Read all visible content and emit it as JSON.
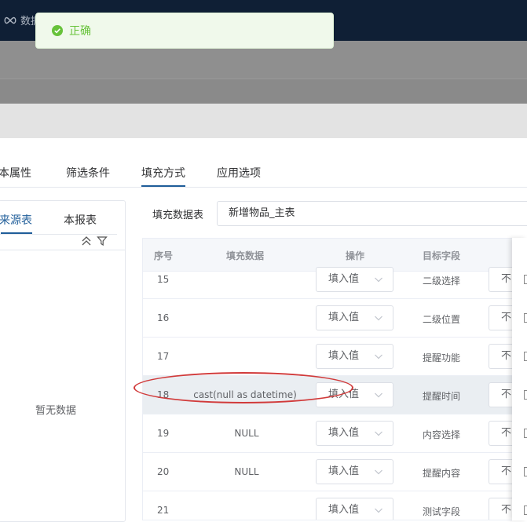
{
  "topbar": {
    "brand_icon": "infinity-icon",
    "brand_text": "数据"
  },
  "toast": {
    "text": "正确",
    "icon": "check-circle-icon",
    "color": "#67c23a"
  },
  "tabs": [
    {
      "label": "本属性"
    },
    {
      "label": "筛选条件"
    },
    {
      "label": "填充方式",
      "active": true
    },
    {
      "label": "应用选项"
    }
  ],
  "left_panel": {
    "tabs": [
      {
        "label": "来源表",
        "active": true
      },
      {
        "label": "本报表"
      }
    ],
    "empty_text": "暂无数据"
  },
  "fill_table": {
    "label": "填充数据表",
    "value": "新增物品_主表"
  },
  "table": {
    "headers": {
      "idx": "序号",
      "data": "填充数据",
      "op": "操作",
      "target": "目标字段"
    },
    "rows": [
      {
        "idx": "15",
        "data": "",
        "op": "填入值",
        "target": "二级选择",
        "extra": "不"
      },
      {
        "idx": "16",
        "data": "",
        "op": "填入值",
        "target": "二级位置",
        "extra": "不"
      },
      {
        "idx": "17",
        "data": "",
        "op": "填入值",
        "target": "提醒功能",
        "extra": "不"
      },
      {
        "idx": "18",
        "data": "cast(null as datetime)",
        "op": "填入值",
        "target": "提醒时间",
        "extra": "不"
      },
      {
        "idx": "19",
        "data": "NULL",
        "op": "填入值",
        "target": "内容选择",
        "extra": "不"
      },
      {
        "idx": "20",
        "data": "NULL",
        "op": "填入值",
        "target": "提醒内容",
        "extra": "不"
      },
      {
        "idx": "21",
        "data": "",
        "op": "填入值",
        "target": "测试字段",
        "extra": "不"
      }
    ]
  },
  "colors": {
    "accent": "#1f5d99",
    "annotation": "#d13a3a",
    "header_bg": "#0f1f35"
  }
}
